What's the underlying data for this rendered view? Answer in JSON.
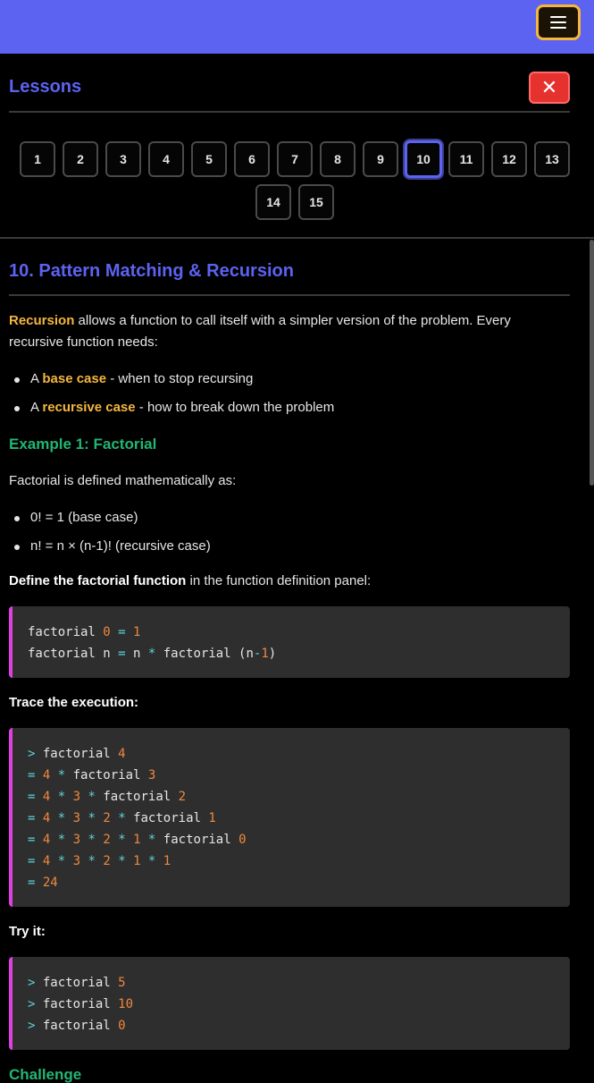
{
  "header": {
    "menu_icon": "hamburger-icon",
    "accent": "#5b63f0",
    "menu_border": "#f4b63f"
  },
  "lessons": {
    "title": "Lessons",
    "close_label": "✕",
    "items": [
      "1",
      "2",
      "3",
      "4",
      "5",
      "6",
      "7",
      "8",
      "9",
      "10",
      "11",
      "12",
      "13",
      "14",
      "15"
    ],
    "active": "10"
  },
  "lesson": {
    "title": "10. Pattern Matching & Recursion",
    "intro_term": "Recursion",
    "intro_rest_1": " allows a function to call itself with a simpler version of the problem. Every",
    "intro_rest_2": "recursive function needs:",
    "bullets": [
      {
        "pre": "A ",
        "term": "base case",
        "post": " - when to stop recursing"
      },
      {
        "pre": "A ",
        "term": "recursive case",
        "post": " - how to break down the problem"
      }
    ],
    "example_title": "Example 1: Factorial",
    "factorial_intro": "Factorial is defined mathematically as:",
    "math_bullets": [
      "0! = 1 (base case)",
      "n! = n × (n-1)! (recursive case)"
    ],
    "define_strong": "Define the factorial function",
    "define_rest": " in the function definition panel:",
    "def_code": [
      [
        [
          "factorial ",
          ""
        ],
        [
          "0",
          "n"
        ],
        [
          " = ",
          "op"
        ],
        [
          "1",
          "n"
        ]
      ],
      [
        [
          "factorial n ",
          ""
        ],
        [
          "=",
          "op"
        ],
        [
          " n ",
          ""
        ],
        [
          "*",
          "op"
        ],
        [
          " factorial (n",
          ""
        ],
        [
          "-",
          "op"
        ],
        [
          "1",
          "n"
        ],
        [
          ")",
          ""
        ]
      ]
    ],
    "trace_label": "Trace the execution:",
    "trace_code": [
      [
        [
          "> ",
          "op"
        ],
        [
          "factorial ",
          ""
        ],
        [
          "4",
          "n"
        ]
      ],
      [
        [
          "= ",
          "op"
        ],
        [
          "4",
          "n"
        ],
        [
          " * ",
          "op"
        ],
        [
          "factorial ",
          ""
        ],
        [
          "3",
          "n"
        ]
      ],
      [
        [
          "= ",
          "op"
        ],
        [
          "4",
          "n"
        ],
        [
          " * ",
          "op"
        ],
        [
          "3",
          "n"
        ],
        [
          " * ",
          "op"
        ],
        [
          "factorial ",
          ""
        ],
        [
          "2",
          "n"
        ]
      ],
      [
        [
          "= ",
          "op"
        ],
        [
          "4",
          "n"
        ],
        [
          " * ",
          "op"
        ],
        [
          "3",
          "n"
        ],
        [
          " * ",
          "op"
        ],
        [
          "2",
          "n"
        ],
        [
          " * ",
          "op"
        ],
        [
          "factorial ",
          ""
        ],
        [
          "1",
          "n"
        ]
      ],
      [
        [
          "= ",
          "op"
        ],
        [
          "4",
          "n"
        ],
        [
          " * ",
          "op"
        ],
        [
          "3",
          "n"
        ],
        [
          " * ",
          "op"
        ],
        [
          "2",
          "n"
        ],
        [
          " * ",
          "op"
        ],
        [
          "1",
          "n"
        ],
        [
          " * ",
          "op"
        ],
        [
          "factorial ",
          ""
        ],
        [
          "0",
          "n"
        ]
      ],
      [
        [
          "= ",
          "op"
        ],
        [
          "4",
          "n"
        ],
        [
          " * ",
          "op"
        ],
        [
          "3",
          "n"
        ],
        [
          " * ",
          "op"
        ],
        [
          "2",
          "n"
        ],
        [
          " * ",
          "op"
        ],
        [
          "1",
          "n"
        ],
        [
          " * ",
          "op"
        ],
        [
          "1",
          "n"
        ]
      ],
      [
        [
          "= ",
          "op"
        ],
        [
          "24",
          "n"
        ]
      ]
    ],
    "try_label": "Try it:",
    "try_code": [
      [
        [
          "> ",
          "op"
        ],
        [
          "factorial ",
          ""
        ],
        [
          "5",
          "n"
        ]
      ],
      [
        [
          "> ",
          "op"
        ],
        [
          "factorial ",
          ""
        ],
        [
          "10",
          "n"
        ]
      ],
      [
        [
          "> ",
          "op"
        ],
        [
          "factorial ",
          ""
        ],
        [
          "0",
          "n"
        ]
      ]
    ],
    "challenge_title": "Challenge"
  }
}
